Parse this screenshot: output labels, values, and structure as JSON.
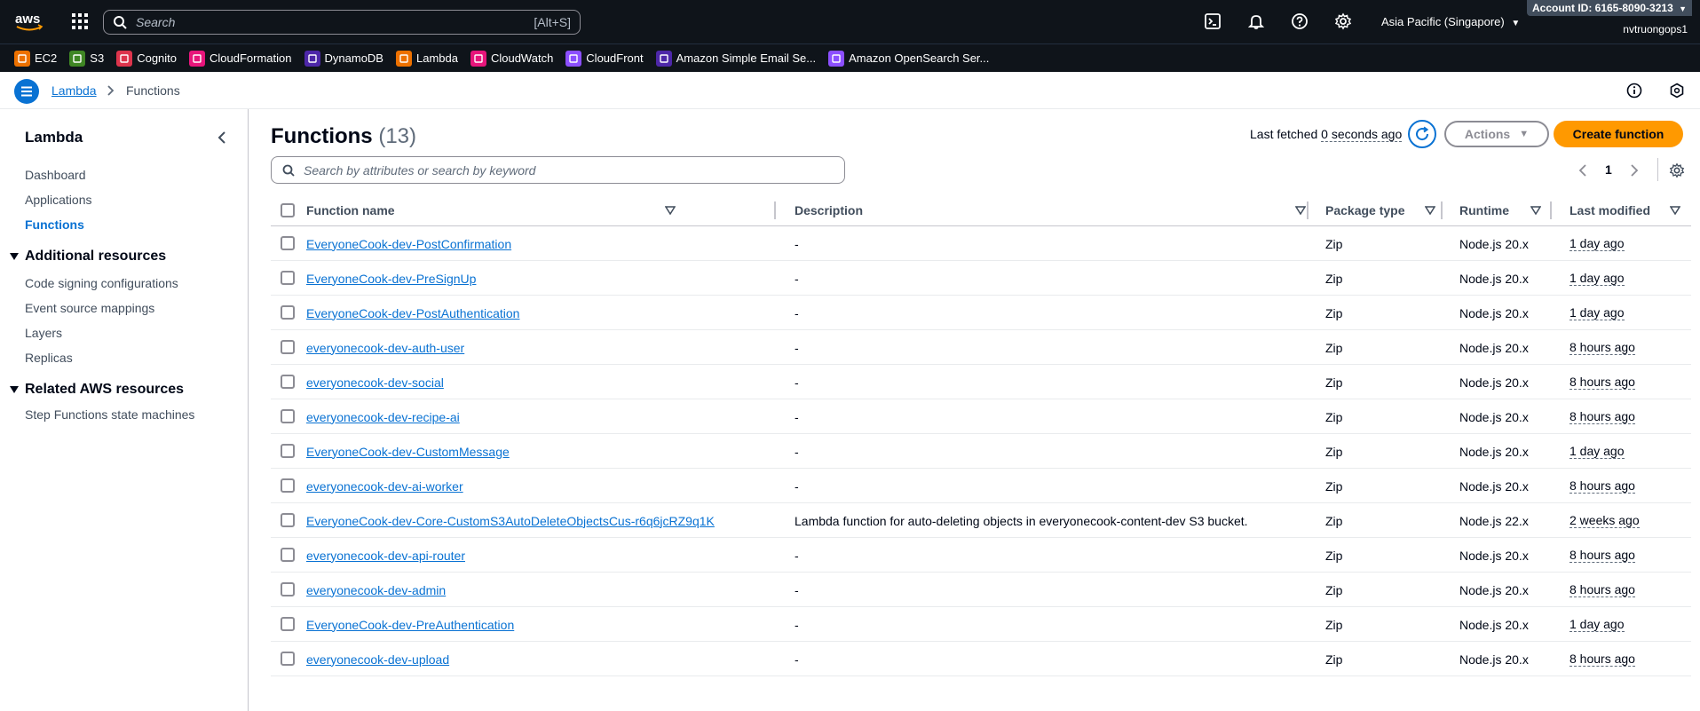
{
  "topnav": {
    "search_placeholder": "Search",
    "search_shortcut": "[Alt+S]",
    "region": "Asia Pacific (Singapore)",
    "account_id": "Account ID: 6165-8090-3213",
    "username": "nvtruongops1"
  },
  "favorites": [
    {
      "label": "EC2",
      "color": "#ed7100",
      "icon": "ec2-icon"
    },
    {
      "label": "S3",
      "color": "#3f8624",
      "icon": "s3-icon"
    },
    {
      "label": "Cognito",
      "color": "#dd344c",
      "icon": "cognito-icon"
    },
    {
      "label": "CloudFormation",
      "color": "#e7157b",
      "icon": "cloudformation-icon"
    },
    {
      "label": "DynamoDB",
      "color": "#4d27a8",
      "icon": "dynamodb-icon"
    },
    {
      "label": "Lambda",
      "color": "#ed7100",
      "icon": "lambda-icon"
    },
    {
      "label": "CloudWatch",
      "color": "#e7157b",
      "icon": "cloudwatch-icon"
    },
    {
      "label": "CloudFront",
      "color": "#8c4fff",
      "icon": "cloudfront-icon"
    },
    {
      "label": "Amazon Simple Email Se...",
      "color": "#4d27a8",
      "icon": "ses-icon"
    },
    {
      "label": "Amazon OpenSearch Ser...",
      "color": "#8c4fff",
      "icon": "opensearch-icon"
    }
  ],
  "breadcrumb": {
    "parent": "Lambda",
    "current": "Functions"
  },
  "sidebar": {
    "title": "Lambda",
    "items": [
      {
        "label": "Dashboard"
      },
      {
        "label": "Applications"
      },
      {
        "label": "Functions"
      }
    ],
    "additional_title": "Additional resources",
    "additional_items": [
      {
        "label": "Code signing configurations"
      },
      {
        "label": "Event source mappings"
      },
      {
        "label": "Layers"
      },
      {
        "label": "Replicas"
      }
    ],
    "related_title": "Related AWS resources",
    "related_items": [
      {
        "label": "Step Functions state machines"
      }
    ]
  },
  "main": {
    "title": "Functions",
    "count": "(13)",
    "last_fetched_prefix": "Last fetched",
    "last_fetched_ago": "0 seconds ago",
    "actions_label": "Actions",
    "create_label": "Create function",
    "filter_placeholder": "Search by attributes or search by keyword",
    "page": "1",
    "columns": {
      "name": "Function name",
      "description": "Description",
      "package": "Package type",
      "runtime": "Runtime",
      "modified": "Last modified"
    },
    "rows": [
      {
        "name": "EveryoneCook-dev-PostConfirmation",
        "description": "-",
        "package": "Zip",
        "runtime": "Node.js 20.x",
        "modified": "1 day ago"
      },
      {
        "name": "EveryoneCook-dev-PreSignUp",
        "description": "-",
        "package": "Zip",
        "runtime": "Node.js 20.x",
        "modified": "1 day ago"
      },
      {
        "name": "EveryoneCook-dev-PostAuthentication",
        "description": "-",
        "package": "Zip",
        "runtime": "Node.js 20.x",
        "modified": "1 day ago"
      },
      {
        "name": "everyonecook-dev-auth-user",
        "description": "-",
        "package": "Zip",
        "runtime": "Node.js 20.x",
        "modified": "8 hours ago"
      },
      {
        "name": "everyonecook-dev-social",
        "description": "-",
        "package": "Zip",
        "runtime": "Node.js 20.x",
        "modified": "8 hours ago"
      },
      {
        "name": "everyonecook-dev-recipe-ai",
        "description": "-",
        "package": "Zip",
        "runtime": "Node.js 20.x",
        "modified": "8 hours ago"
      },
      {
        "name": "EveryoneCook-dev-CustomMessage",
        "description": "-",
        "package": "Zip",
        "runtime": "Node.js 20.x",
        "modified": "1 day ago"
      },
      {
        "name": "everyonecook-dev-ai-worker",
        "description": "-",
        "package": "Zip",
        "runtime": "Node.js 20.x",
        "modified": "8 hours ago"
      },
      {
        "name": "EveryoneCook-dev-Core-CustomS3AutoDeleteObjectsCus-r6q6jcRZ9q1K",
        "description": "Lambda function for auto-deleting objects in everyonecook-content-dev S3 bucket.",
        "package": "Zip",
        "runtime": "Node.js 22.x",
        "modified": "2 weeks ago"
      },
      {
        "name": "everyonecook-dev-api-router",
        "description": "-",
        "package": "Zip",
        "runtime": "Node.js 20.x",
        "modified": "8 hours ago"
      },
      {
        "name": "everyonecook-dev-admin",
        "description": "-",
        "package": "Zip",
        "runtime": "Node.js 20.x",
        "modified": "8 hours ago"
      },
      {
        "name": "EveryoneCook-dev-PreAuthentication",
        "description": "-",
        "package": "Zip",
        "runtime": "Node.js 20.x",
        "modified": "1 day ago"
      },
      {
        "name": "everyonecook-dev-upload",
        "description": "-",
        "package": "Zip",
        "runtime": "Node.js 20.x",
        "modified": "8 hours ago"
      }
    ]
  },
  "colors": {
    "nav_bg": "#0f141a",
    "link": "#0972d3",
    "primary_button": "#ff9900"
  }
}
